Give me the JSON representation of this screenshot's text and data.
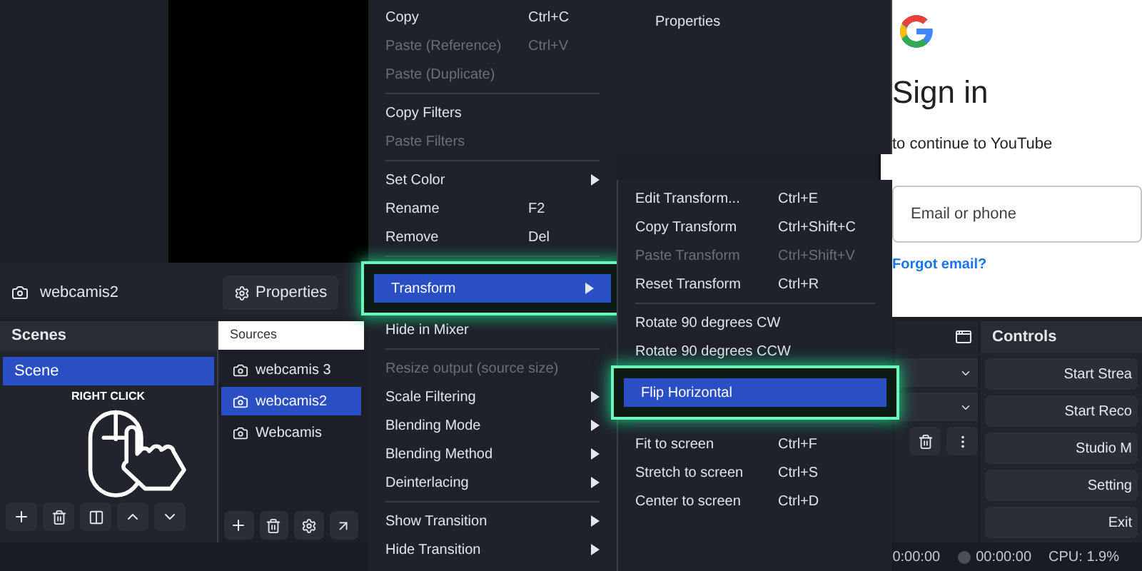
{
  "source_bar": {
    "source_name": "webcamis2",
    "properties_button": "Properties"
  },
  "scenes": {
    "title": "Scenes",
    "items": [
      {
        "label": "Scene",
        "selected": true
      }
    ],
    "annotation": "RIGHT CLICK"
  },
  "sources": {
    "title": "Sources",
    "items": [
      {
        "label": "webcamis 3",
        "selected": false
      },
      {
        "label": "webcamis2",
        "selected": true
      },
      {
        "label": "Webcamis",
        "selected": false
      }
    ]
  },
  "context_menu": {
    "items": [
      {
        "kind": "item",
        "label": "Copy",
        "shortcut": "Ctrl+C",
        "disabled": false,
        "submenu": false,
        "selected": false
      },
      {
        "kind": "item",
        "label": "Paste (Reference)",
        "shortcut": "Ctrl+V",
        "disabled": true,
        "submenu": false,
        "selected": false
      },
      {
        "kind": "item",
        "label": "Paste (Duplicate)",
        "disabled": true,
        "submenu": false,
        "selected": false
      },
      {
        "kind": "separator"
      },
      {
        "kind": "item",
        "label": "Copy Filters",
        "disabled": false,
        "submenu": false,
        "selected": false
      },
      {
        "kind": "item",
        "label": "Paste Filters",
        "disabled": true,
        "submenu": false,
        "selected": false
      },
      {
        "kind": "separator"
      },
      {
        "kind": "item",
        "label": "Set Color",
        "disabled": false,
        "submenu": true,
        "selected": false
      },
      {
        "kind": "item",
        "label": "Rename",
        "shortcut": "F2",
        "disabled": false,
        "submenu": false,
        "selected": false
      },
      {
        "kind": "item",
        "label": "Remove",
        "shortcut": "Del",
        "disabled": false,
        "submenu": false,
        "selected": false
      },
      {
        "kind": "separator"
      },
      {
        "kind": "item",
        "label": "Transform",
        "disabled": false,
        "submenu": true,
        "selected": true
      },
      {
        "kind": "item",
        "label": "Hide in Mixer",
        "disabled": false,
        "submenu": false,
        "selected": false
      },
      {
        "kind": "separator"
      },
      {
        "kind": "item",
        "label": "Resize output (source size)",
        "disabled": true,
        "submenu": false,
        "selected": false
      },
      {
        "kind": "item",
        "label": "Scale Filtering",
        "disabled": false,
        "submenu": true,
        "selected": false
      },
      {
        "kind": "item",
        "label": "Blending Mode",
        "disabled": false,
        "submenu": true,
        "selected": false
      },
      {
        "kind": "item",
        "label": "Blending Method",
        "disabled": false,
        "submenu": true,
        "selected": false
      },
      {
        "kind": "item",
        "label": "Deinterlacing",
        "disabled": false,
        "submenu": true,
        "selected": false
      },
      {
        "kind": "separator"
      },
      {
        "kind": "item",
        "label": "Show Transition",
        "disabled": false,
        "submenu": true,
        "selected": false
      },
      {
        "kind": "item",
        "label": "Hide Transition",
        "disabled": false,
        "submenu": true,
        "selected": false
      }
    ]
  },
  "properties_menu": {
    "label": "Properties"
  },
  "transform_menu": {
    "items": [
      {
        "kind": "item",
        "label": "Edit Transform...",
        "shortcut": "Ctrl+E",
        "disabled": false,
        "submenu": false,
        "selected": false
      },
      {
        "kind": "item",
        "label": "Copy Transform",
        "shortcut": "Ctrl+Shift+C",
        "disabled": false,
        "submenu": false,
        "selected": false
      },
      {
        "kind": "item",
        "label": "Paste Transform",
        "shortcut": "Ctrl+Shift+V",
        "disabled": true,
        "submenu": false,
        "selected": false
      },
      {
        "kind": "item",
        "label": "Reset Transform",
        "shortcut": "Ctrl+R",
        "disabled": false,
        "submenu": false,
        "selected": false
      },
      {
        "kind": "separator"
      },
      {
        "kind": "item",
        "label": "Rotate 90 degrees CW",
        "disabled": false,
        "submenu": false,
        "selected": false
      },
      {
        "kind": "item",
        "label": "Rotate 90 degrees CCW",
        "disabled": false,
        "submenu": false,
        "selected": false
      },
      {
        "kind": "item",
        "label": "Flip Horizontal",
        "disabled": false,
        "submenu": false,
        "selected": true
      },
      {
        "kind": "separator"
      },
      {
        "kind": "item",
        "label": "Fit to screen",
        "shortcut": "Ctrl+F",
        "disabled": false,
        "submenu": false,
        "selected": false
      },
      {
        "kind": "item",
        "label": "Stretch to screen",
        "shortcut": "Ctrl+S",
        "disabled": false,
        "submenu": false,
        "selected": false
      },
      {
        "kind": "item",
        "label": "Center to screen",
        "shortcut": "Ctrl+D",
        "disabled": false,
        "submenu": false,
        "selected": false
      }
    ]
  },
  "sign_in": {
    "title": "Sign in",
    "subtitle": "to continue to YouTube",
    "email_field": {
      "placeholder": "Email or phone"
    },
    "link": "Forgot email?"
  },
  "controls": {
    "title": "Controls",
    "buttons": [
      "Start Strea",
      "Start Reco",
      "Studio M",
      "Setting",
      "Exit"
    ]
  },
  "status_bar": {
    "items": [
      "0:00:00",
      "00:00:00",
      "CPU: 1.9%"
    ]
  }
}
